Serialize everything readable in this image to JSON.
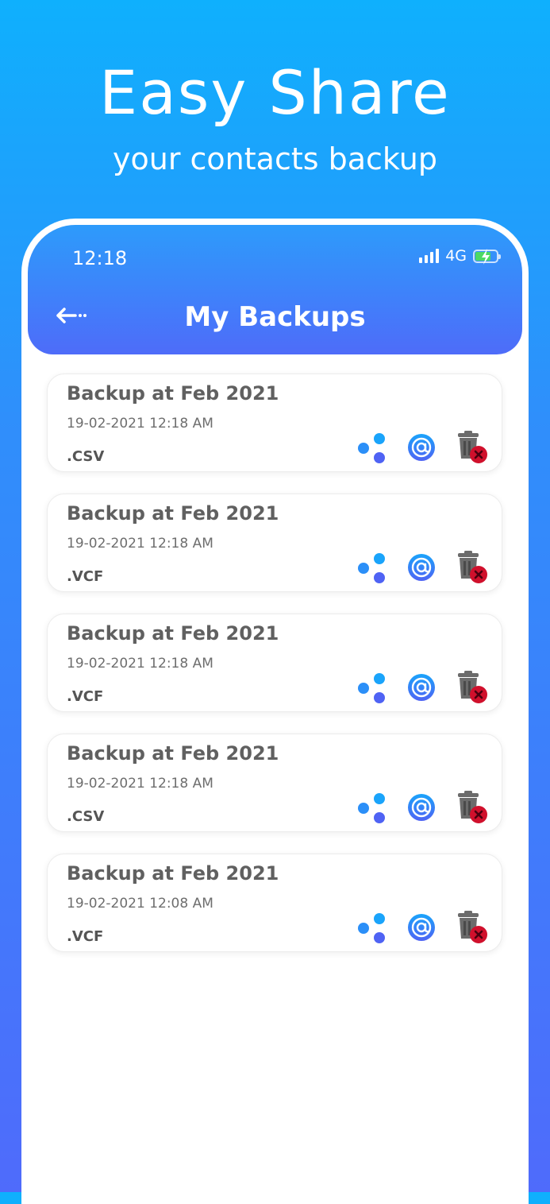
{
  "promo": {
    "title": "Easy Share",
    "subtitle": "your contacts backup"
  },
  "status_bar": {
    "time": "12:18",
    "network": "4G"
  },
  "app_bar": {
    "title": "My Backups",
    "back_icon": "back-arrow-icon"
  },
  "icons": {
    "share": "share-icon",
    "email": "email-at-icon",
    "delete": "delete-trash-icon"
  },
  "colors": {
    "accent_blue": "#2f8ffb",
    "accent_indigo": "#4e6cf9",
    "delete_red": "#d0102c"
  },
  "backups": [
    {
      "title": "Backup at Feb 2021",
      "date": "19-02-2021 12:18 AM",
      "type": ".CSV"
    },
    {
      "title": "Backup at Feb 2021",
      "date": "19-02-2021 12:18 AM",
      "type": ".VCF"
    },
    {
      "title": "Backup at Feb 2021",
      "date": "19-02-2021 12:18 AM",
      "type": ".VCF"
    },
    {
      "title": "Backup at Feb 2021",
      "date": "19-02-2021 12:18 AM",
      "type": ".CSV"
    },
    {
      "title": "Backup at Feb 2021",
      "date": "19-02-2021 12:08 AM",
      "type": ".VCF"
    }
  ]
}
